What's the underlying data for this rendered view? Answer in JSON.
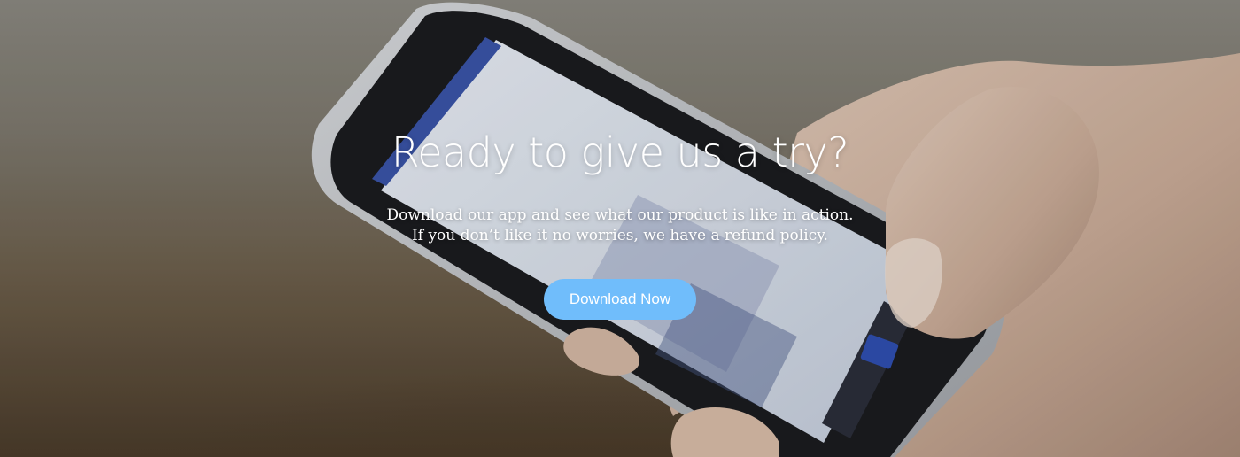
{
  "hero": {
    "headline": "Ready to give us a try?",
    "subtext_line1": "Download our app and see what our product is like in action.",
    "subtext_line2": "If you don’t like it no worries, we have a refund policy.",
    "cta_label": "Download Now",
    "accent_color": "#70bdfb",
    "background_image": "hand-holding-smartphone-photo"
  }
}
